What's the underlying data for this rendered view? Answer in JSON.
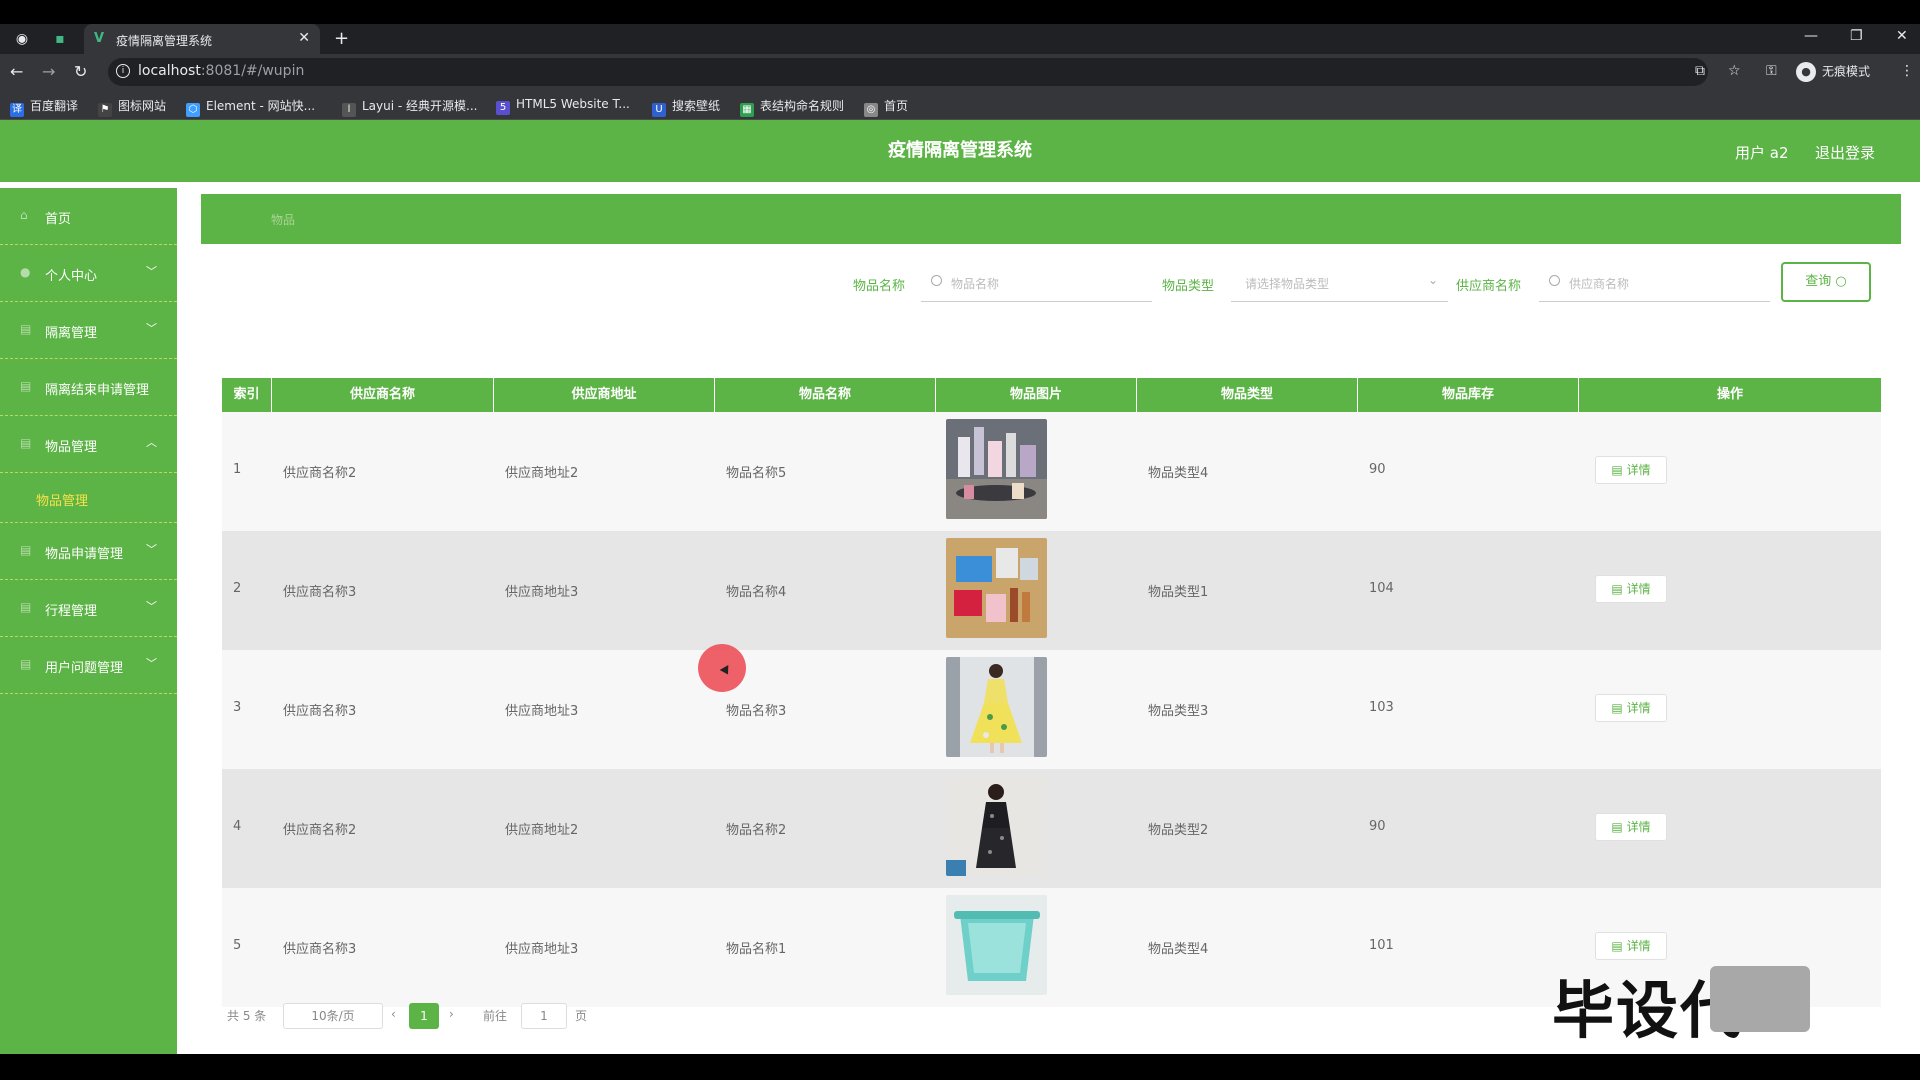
{
  "browser": {
    "tab_title": "疫情隔离管理系统",
    "tab_favicon": "V",
    "url_host": "localhost",
    "url_rest": ":8081/#/wupin",
    "incognito_label": "无痕模式",
    "bookmarks": [
      {
        "label": "百度翻译",
        "icon": "translate-icon",
        "color": "#2b6fe6"
      },
      {
        "label": "图标网站",
        "icon": "flag-icon",
        "color": "#444444"
      },
      {
        "label": "Element - 网站快...",
        "icon": "element-icon",
        "color": "#409eff"
      },
      {
        "label": "Layui - 经典开源模...",
        "icon": "layui-icon",
        "color": "#555555"
      },
      {
        "label": "HTML5 Website T...",
        "icon": "html5-icon",
        "color": "#5a4fcf"
      },
      {
        "label": "搜索壁纸",
        "icon": "wallpaper-icon",
        "color": "#3060d0"
      },
      {
        "label": "表结构命名规则",
        "icon": "sheet-icon",
        "color": "#2e9e4f"
      },
      {
        "label": "首页",
        "icon": "globe-icon",
        "color": "#888888"
      }
    ]
  },
  "header": {
    "title": "疫情隔离管理系统",
    "user": "用户 a2",
    "logout": "退出登录"
  },
  "sidebar": {
    "items": [
      {
        "label": "首页",
        "icon": "home-icon",
        "chevron": ""
      },
      {
        "label": "个人中心",
        "icon": "user-icon",
        "chevron": "﹀"
      },
      {
        "label": "隔离管理",
        "icon": "menu-icon",
        "chevron": "﹀"
      },
      {
        "label": "隔离结束申请管理",
        "icon": "menu-icon",
        "chevron": ""
      },
      {
        "label": "物品管理",
        "icon": "menu-icon",
        "chevron": "︿"
      },
      {
        "label": "物品申请管理",
        "icon": "menu-icon",
        "chevron": "﹀"
      },
      {
        "label": "行程管理",
        "icon": "menu-icon",
        "chevron": "﹀"
      },
      {
        "label": "用户问题管理",
        "icon": "menu-icon",
        "chevron": "﹀"
      }
    ],
    "sub_item": "物品管理"
  },
  "breadcrumb": "物品",
  "search": {
    "name_label": "物品名称",
    "name_placeholder": "物品名称",
    "type_label": "物品类型",
    "type_placeholder": "请选择物品类型",
    "supplier_label": "供应商名称",
    "supplier_placeholder": "供应商名称",
    "button": "查询"
  },
  "table": {
    "headers": [
      "索引",
      "供应商名称",
      "供应商地址",
      "物品名称",
      "物品图片",
      "物品类型",
      "物品库存",
      "操作"
    ],
    "detail_label": "详情",
    "rows": [
      {
        "index": "1",
        "supplier": "供应商名称2",
        "address": "供应商地址2",
        "name": "物品名称5",
        "type": "物品类型4",
        "stock": "90",
        "image": "cosmetics-photo"
      },
      {
        "index": "2",
        "supplier": "供应商名称3",
        "address": "供应商地址3",
        "name": "物品名称4",
        "type": "物品类型1",
        "stock": "104",
        "image": "products-photo"
      },
      {
        "index": "3",
        "supplier": "供应商名称3",
        "address": "供应商地址3",
        "name": "物品名称3",
        "type": "物品类型3",
        "stock": "103",
        "image": "yellow-dress-photo"
      },
      {
        "index": "4",
        "supplier": "供应商名称2",
        "address": "供应商地址2",
        "name": "物品名称2",
        "type": "物品类型2",
        "stock": "90",
        "image": "black-dress-photo"
      },
      {
        "index": "5",
        "supplier": "供应商名称3",
        "address": "供应商地址3",
        "name": "物品名称1",
        "type": "物品类型4",
        "stock": "101",
        "image": "teal-box-photo"
      }
    ]
  },
  "pager": {
    "total": "共 5 条",
    "page_size": "10条/页",
    "prev": "‹",
    "current": "1",
    "next": "›",
    "goto": "前往",
    "goto_value": "1",
    "page_unit": "页"
  },
  "watermark": "毕设代",
  "colors": {
    "primary_green": "#5cb346",
    "submenu_yellow": "#f7e24a",
    "cursor_red": "#ec4650"
  }
}
